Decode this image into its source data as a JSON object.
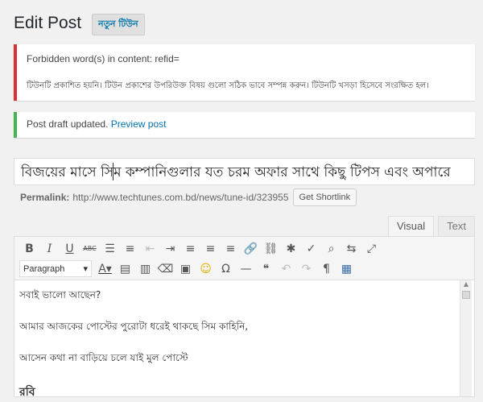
{
  "page": {
    "title": "Edit Post",
    "new_button": "নতুন টিউন"
  },
  "notices": {
    "error_line1": "Forbidden word(s) in content: refid=",
    "error_line2": "টিউনটি প্রকাশিত হয়নি। টিউন প্রকাশের উপরিউক্ত বিষয় গুলো সঠিক ভাবে সম্পন্ন করুন। টিউনটি খসড়া হিসেবে সংরক্ষিত হল।",
    "success_text": "Post draft updated.",
    "success_link": "Preview post"
  },
  "post": {
    "title": "বিজয়ের মাসে সিম কম্পানিগুলার যত চরম অফার সাথে কিছু টিপস এবং অপারে",
    "permalink_label": "Permalink:",
    "permalink_url": "http://www.techtunes.com.bd/news/tune-id/323955",
    "shortlink_button": "Get Shortlink"
  },
  "editor": {
    "tabs": [
      "Visual",
      "Text"
    ],
    "format_select": "Paragraph",
    "content": [
      "সবাই ভালো আছেন?",
      "আমার আজকের পোস্টের পুরোটা ধরেই থাকছে সিম কাহিনি,",
      "আসেন কথা না বাড়িয়ে চলে যাই মুল পোস্টে",
      "রবি"
    ]
  },
  "colors": {
    "error": "#dc3232",
    "success": "#46b450",
    "link": "#0073aa"
  }
}
